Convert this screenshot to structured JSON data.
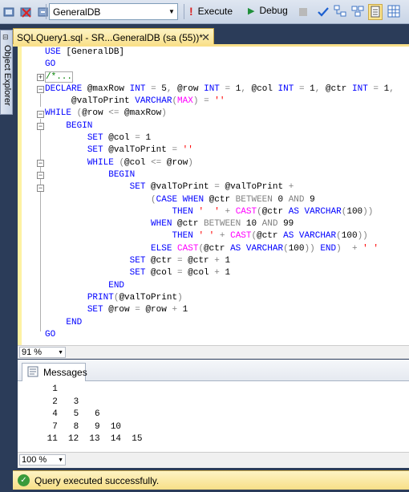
{
  "toolbar": {
    "database": "GeneralDB",
    "execute_label": "Execute",
    "debug_label": "Debug"
  },
  "side_panel": {
    "object_explorer_label": "Object Explorer"
  },
  "document_tab": {
    "title": "SQLQuery1.sql - SR...GeneralDB (sa (55))*",
    "close_glyph": "✕"
  },
  "editor": {
    "zoom": "91 %",
    "lines": [
      "USE [GeneralDB]",
      "GO",
      "/*...",
      "DECLARE @maxRow INT = 5, @row INT = 1, @col INT = 1, @ctr INT = 1,",
      "     @valToPrint VARCHAR(MAX) = ''",
      "WHILE (@row <= @maxRow)",
      "    BEGIN",
      "        SET @col = 1",
      "        SET @valToPrint = ''",
      "        WHILE (@col <= @row)",
      "            BEGIN",
      "                SET @valToPrint = @valToPrint +",
      "                    (CASE WHEN @ctr BETWEEN 0 AND 9",
      "                        THEN '  ' + CAST(@ctr AS VARCHAR(100))",
      "                    WHEN @ctr BETWEEN 10 AND 99",
      "                        THEN ' ' + CAST(@ctr AS VARCHAR(100))",
      "                    ELSE CAST(@ctr AS VARCHAR(100)) END)  + ' '",
      "                SET @ctr = @ctr + 1",
      "                SET @col = @col + 1",
      "            END",
      "        PRINT(@valToPrint)",
      "        SET @row = @row + 1",
      "    END",
      "GO"
    ]
  },
  "results": {
    "tab_label": "Messages",
    "zoom": "100 %",
    "output": [
      "  1",
      "  2   3",
      "  4   5   6",
      "  7   8   9  10",
      " 11  12  13  14  15"
    ]
  },
  "status": {
    "message": "Query executed successfully."
  }
}
